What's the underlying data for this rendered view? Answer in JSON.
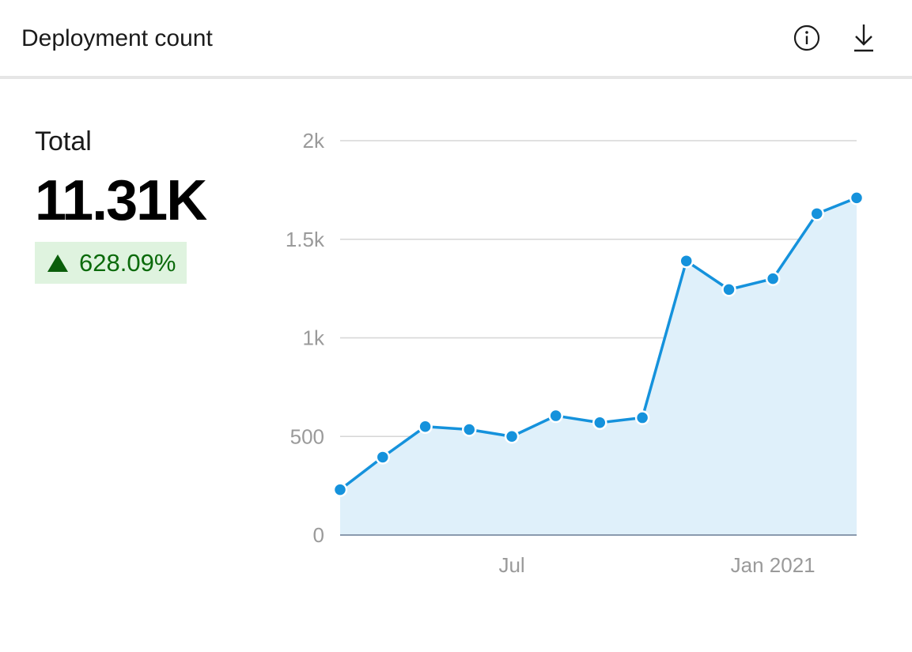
{
  "header": {
    "title": "Deployment count",
    "info_icon": "info-icon",
    "download_icon": "download-icon"
  },
  "summary": {
    "label": "Total",
    "value": "11.31K",
    "change": "628.09%",
    "change_direction": "up",
    "change_color": "#0b6a0b",
    "change_bg": "#dff3df"
  },
  "colors": {
    "line": "#1592dc",
    "area": "#dff0fa",
    "grid": "#d6d6d6"
  },
  "chart_data": {
    "type": "area",
    "title": "",
    "xlabel": "",
    "ylabel": "",
    "ylim": [
      0,
      2000
    ],
    "yticks": [
      0,
      500,
      1000,
      1500,
      2000
    ],
    "ytick_labels": [
      "0",
      "500",
      "1k",
      "1.5k",
      "2k"
    ],
    "xtick_labels": [
      {
        "label": "Jul",
        "at": "2020-07"
      },
      {
        "label": "Jan 2021",
        "at": "2021-01"
      }
    ],
    "x": [
      "2020-03-02",
      "2020-04-01",
      "2020-05-01",
      "2020-06-01",
      "2020-07-01",
      "2020-08-01",
      "2020-09-01",
      "2020-10-01",
      "2020-11-01",
      "2020-12-01",
      "2021-01-01",
      "2021-02-01",
      "2021-03-01"
    ],
    "series": [
      {
        "values": [
          230,
          395,
          550,
          535,
          500,
          605,
          570,
          595,
          1390,
          1245,
          1300,
          1630,
          1710
        ]
      }
    ],
    "grid": true,
    "legend": "none"
  }
}
